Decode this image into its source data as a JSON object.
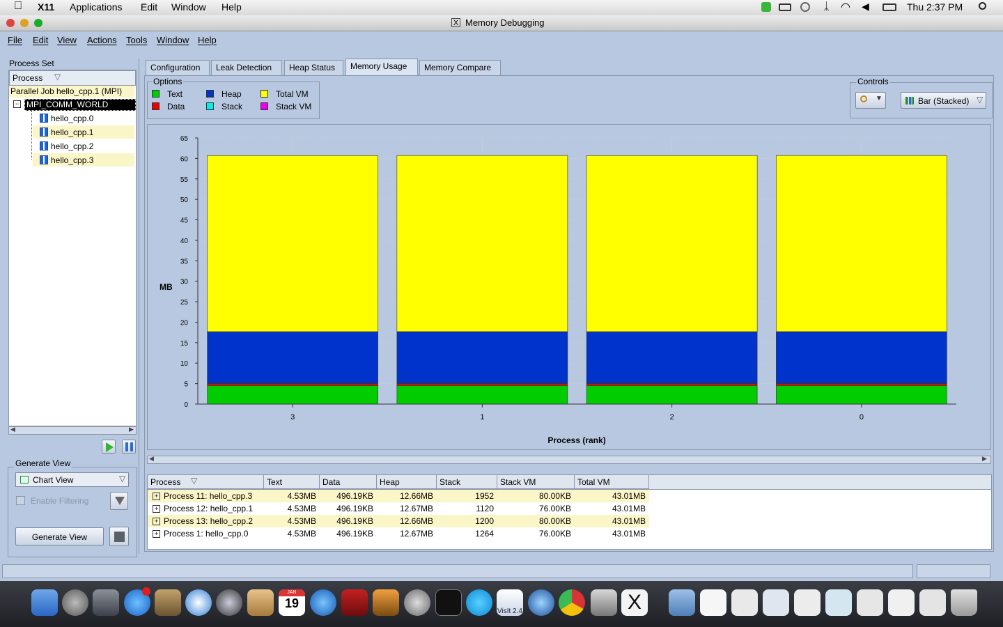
{
  "menubar_mac": {
    "app": "X11",
    "items": [
      "Applications",
      "Edit",
      "Window",
      "Help"
    ],
    "clock": "Thu 2:37 PM"
  },
  "window": {
    "title": "Memory Debugging"
  },
  "menu": {
    "items": [
      "File",
      "Edit",
      "View",
      "Actions",
      "Tools",
      "Window",
      "Help"
    ]
  },
  "left": {
    "process_set_label": "Process Set",
    "column_header": "Process",
    "job_label": "Parallel Job hello_cpp.1 (MPI)",
    "group_label": "MPI_COMM_WORLD",
    "processes": [
      "hello_cpp.0",
      "hello_cpp.1",
      "hello_cpp.2",
      "hello_cpp.3"
    ],
    "generate_view_label": "Generate View",
    "view_select": "Chart View",
    "enable_filtering": "Enable Filtering",
    "generate_button": "Generate View"
  },
  "tabs": [
    "Configuration",
    "Leak Detection",
    "Heap Status",
    "Memory Usage",
    "Memory Compare"
  ],
  "active_tab": "Memory Usage",
  "options": {
    "label": "Options",
    "items": [
      {
        "name": "Text",
        "color": "#00cc00"
      },
      {
        "name": "Heap",
        "color": "#0033cc"
      },
      {
        "name": "Total VM",
        "color": "#ffff00"
      },
      {
        "name": "Data",
        "color": "#ee0000"
      },
      {
        "name": "Stack",
        "color": "#00eeee"
      },
      {
        "name": "Stack VM",
        "color": "#ee00ee"
      }
    ]
  },
  "controls": {
    "label": "Controls",
    "chart_type": "Bar (Stacked)"
  },
  "chart_data": {
    "type": "bar",
    "stacked": true,
    "categories": [
      "3",
      "1",
      "2",
      "0"
    ],
    "series": [
      {
        "name": "Text",
        "color": "#00cc00",
        "values": [
          4.53,
          4.53,
          4.53,
          4.53
        ]
      },
      {
        "name": "Data",
        "color": "#ee0000",
        "values": [
          0.5,
          0.5,
          0.5,
          0.5
        ]
      },
      {
        "name": "Heap",
        "color": "#0033cc",
        "values": [
          12.66,
          12.67,
          12.66,
          12.67
        ]
      },
      {
        "name": "Total VM",
        "color": "#ffff00",
        "values": [
          43.01,
          43.01,
          43.01,
          43.01
        ]
      }
    ],
    "xlabel": "Process (rank)",
    "ylabel": "MB",
    "ylim": [
      0,
      65
    ],
    "yticks": [
      0,
      5,
      10,
      15,
      20,
      25,
      30,
      35,
      40,
      45,
      50,
      55,
      60,
      65
    ],
    "grid": true
  },
  "table": {
    "headers": [
      "Process",
      "Text",
      "Data",
      "Heap",
      "Stack",
      "Stack VM",
      "Total VM"
    ],
    "rows": [
      [
        "Process 11: hello_cpp.3",
        "4.53MB",
        "496.19KB",
        "12.66MB",
        "1952",
        "80.00KB",
        "43.01MB"
      ],
      [
        "Process 12: hello_cpp.1",
        "4.53MB",
        "496.19KB",
        "12.67MB",
        "1120",
        "76.00KB",
        "43.01MB"
      ],
      [
        "Process 13: hello_cpp.2",
        "4.53MB",
        "496.19KB",
        "12.66MB",
        "1200",
        "80.00KB",
        "43.01MB"
      ],
      [
        "Process 1: hello_cpp.0",
        "4.53MB",
        "496.19KB",
        "12.67MB",
        "1264",
        "76.00KB",
        "43.01MB"
      ]
    ]
  },
  "dock": {
    "calendar_month": "JAN",
    "calendar_day": "19",
    "visit_label": "VisIt 2.4"
  }
}
